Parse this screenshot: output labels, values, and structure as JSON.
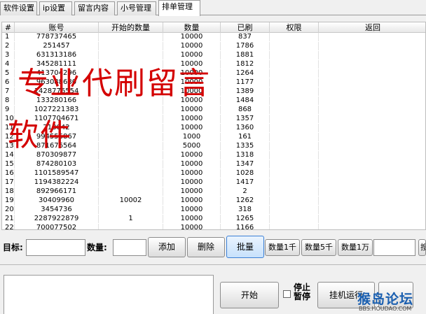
{
  "tabs": [
    "软件设置",
    "ip设置",
    "留言内容",
    "小号管理",
    "排单管理"
  ],
  "table": {
    "headers": [
      "#",
      "账号",
      "开始的数量",
      "数量",
      "已刷",
      "权限",
      "返回"
    ],
    "rows": [
      [
        "1",
        "778737465",
        "",
        "10000",
        "837",
        "",
        ""
      ],
      [
        "2",
        "251457",
        "",
        "10000",
        "1786",
        "",
        ""
      ],
      [
        "3",
        "631313186",
        "",
        "10000",
        "1881",
        "",
        ""
      ],
      [
        "4",
        "345281111",
        "",
        "10000",
        "1812",
        "",
        ""
      ],
      [
        "5",
        "413704296",
        "",
        "10000",
        "1264",
        "",
        ""
      ],
      [
        "6",
        "963088680",
        "",
        "10000",
        "1177",
        "",
        ""
      ],
      [
        "7",
        "1428776554",
        "",
        "10000",
        "1389",
        "",
        ""
      ],
      [
        "8",
        "133280166",
        "",
        "10000",
        "1484",
        "",
        ""
      ],
      [
        "9",
        "1027221383",
        "",
        "10000",
        "868",
        "",
        ""
      ],
      [
        "10",
        "1107704671",
        "",
        "10000",
        "1357",
        "",
        ""
      ],
      [
        "11",
        "718042",
        "",
        "10000",
        "1360",
        "",
        ""
      ],
      [
        "12",
        "994556867",
        "",
        "1000",
        "161",
        "",
        ""
      ],
      [
        "13",
        "871676564",
        "",
        "5000",
        "1335",
        "",
        ""
      ],
      [
        "14",
        "870309877",
        "",
        "10000",
        "1318",
        "",
        ""
      ],
      [
        "15",
        "874280103",
        "",
        "10000",
        "1347",
        "",
        ""
      ],
      [
        "16",
        "1101589547",
        "",
        "10000",
        "1028",
        "",
        ""
      ],
      [
        "17",
        "1194382224",
        "",
        "10000",
        "1417",
        "",
        ""
      ],
      [
        "18",
        "892966171",
        "",
        "10000",
        "2",
        "",
        ""
      ],
      [
        "19",
        "30409960",
        "10002",
        "10000",
        "1262",
        "",
        ""
      ],
      [
        "20",
        "3454736",
        "",
        "10000",
        "318",
        "",
        ""
      ],
      [
        "21",
        "2287922879",
        "1",
        "10000",
        "1265",
        "",
        ""
      ],
      [
        "22",
        "700077502",
        "",
        "10000",
        "1166",
        "",
        ""
      ]
    ]
  },
  "watermark": {
    "line1": "专业代刷留言",
    "line2": "软件"
  },
  "controls": {
    "target_label": "目标:",
    "target_value": "",
    "qty_label": "数量:",
    "qty_value": "",
    "add_btn": "添加",
    "delete_btn": "删除",
    "batch_btn": "批量",
    "qty1k_btn": "数量1千",
    "qty5k_btn": "数量5千",
    "qty10k_btn": "数量1万",
    "search_value": "",
    "search_btn": "搜"
  },
  "bottom": {
    "start_btn": "开始",
    "stop_label": "停止",
    "pause_label": "暂停",
    "hang_btn": "挂机运行",
    "brand_text": "猴岛论坛",
    "brand_url": "BBS.HOUDAO.COM"
  },
  "colors": {
    "watermark": "#d40000",
    "accent": "#3a7fd5",
    "brand": "#1a5fb0"
  }
}
